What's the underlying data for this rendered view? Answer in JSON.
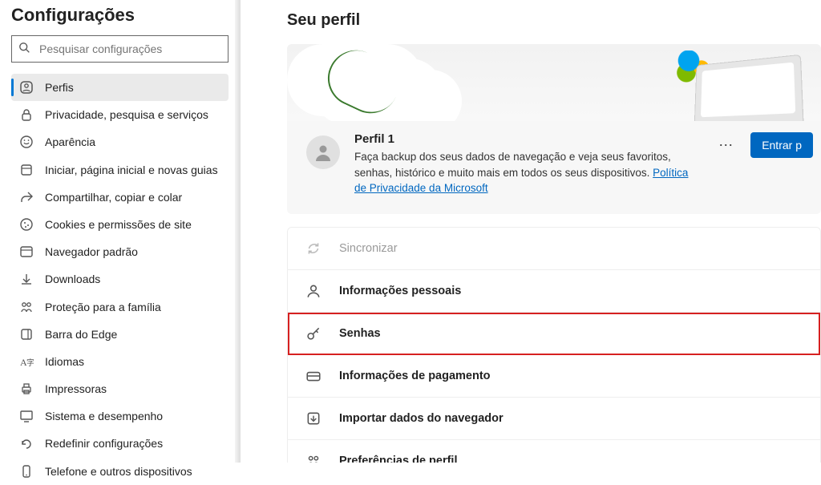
{
  "sidebar": {
    "title": "Configurações",
    "search_placeholder": "Pesquisar configurações",
    "items": [
      {
        "label": "Perfis",
        "icon": "profile",
        "active": true
      },
      {
        "label": "Privacidade, pesquisa e serviços",
        "icon": "lock"
      },
      {
        "label": "Aparência",
        "icon": "appearance"
      },
      {
        "label": "Iniciar, página inicial e novas guias",
        "icon": "start"
      },
      {
        "label": "Compartilhar, copiar e colar",
        "icon": "share"
      },
      {
        "label": "Cookies e permissões de site",
        "icon": "cookie"
      },
      {
        "label": "Navegador padrão",
        "icon": "browser"
      },
      {
        "label": "Downloads",
        "icon": "download"
      },
      {
        "label": "Proteção para a família",
        "icon": "family"
      },
      {
        "label": "Barra do Edge",
        "icon": "edgebar"
      },
      {
        "label": "Idiomas",
        "icon": "language"
      },
      {
        "label": "Impressoras",
        "icon": "printer"
      },
      {
        "label": "Sistema e desempenho",
        "icon": "system"
      },
      {
        "label": "Redefinir configurações",
        "icon": "reset"
      },
      {
        "label": "Telefone e outros dispositivos",
        "icon": "phone"
      }
    ]
  },
  "main": {
    "title": "Seu perfil",
    "profile": {
      "name": "Perfil 1",
      "desc_pre": "Faça backup dos seus dados de navegação e veja seus favoritos, senhas, histórico e muito mais em todos os seus dispositivos. ",
      "link": "Política de Privacidade da Microsoft",
      "signin": "Entrar p"
    },
    "settings": [
      {
        "label": "Sincronizar",
        "icon": "sync",
        "disabled": true
      },
      {
        "label": "Informações pessoais",
        "icon": "person"
      },
      {
        "label": "Senhas",
        "icon": "key",
        "highlighted": true
      },
      {
        "label": "Informações de pagamento",
        "icon": "card"
      },
      {
        "label": "Importar dados do navegador",
        "icon": "import"
      },
      {
        "label": "Preferências de perfil",
        "icon": "prefs"
      }
    ]
  }
}
